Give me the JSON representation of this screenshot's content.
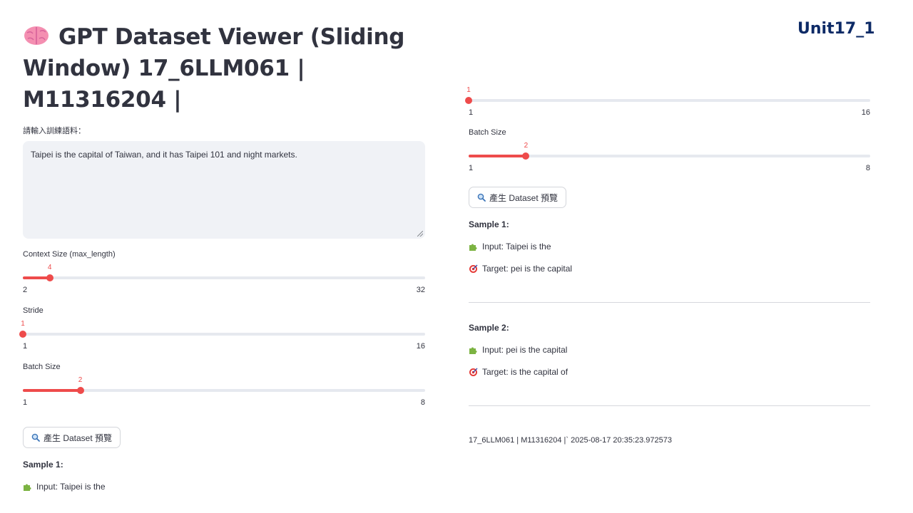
{
  "badge": "Unit17_1",
  "title": "GPT Dataset Viewer (Sliding Window) 17_6LLM061 | M11316204 |",
  "input": {
    "label": "請輸入訓練語料：",
    "value": "Taipei is the capital of Taiwan, and it has Taipei 101 and night markets."
  },
  "left_sliders": [
    {
      "label": "Context Size (max_length)",
      "value": 4,
      "min": 2,
      "max": 32
    },
    {
      "label": "Stride",
      "value": 1,
      "min": 1,
      "max": 16
    },
    {
      "label": "Batch Size",
      "value": 2,
      "min": 1,
      "max": 8
    }
  ],
  "right_sliders": [
    {
      "label": "",
      "value": 1,
      "min": 1,
      "max": 16
    },
    {
      "label": "Batch Size",
      "value": 2,
      "min": 1,
      "max": 8
    }
  ],
  "button_label": "產生 Dataset 預覽",
  "left_sample": {
    "heading": "Sample 1:",
    "input": "Input: Taipei is the"
  },
  "right_samples": [
    {
      "heading": "Sample 1:",
      "input": "Input: Taipei is the",
      "target": "Target: pei is the capital"
    },
    {
      "heading": "Sample 2:",
      "input": "Input: pei is the capital",
      "target": "Target: is the capital of"
    }
  ],
  "footer": "17_6LLM061 | M11316204 |` 2025-08-17 20:35:23.972573",
  "colors": {
    "accent": "#ee4b4b",
    "badge": "#0d2a66",
    "text": "#31333f",
    "track": "#e6e9ef"
  }
}
